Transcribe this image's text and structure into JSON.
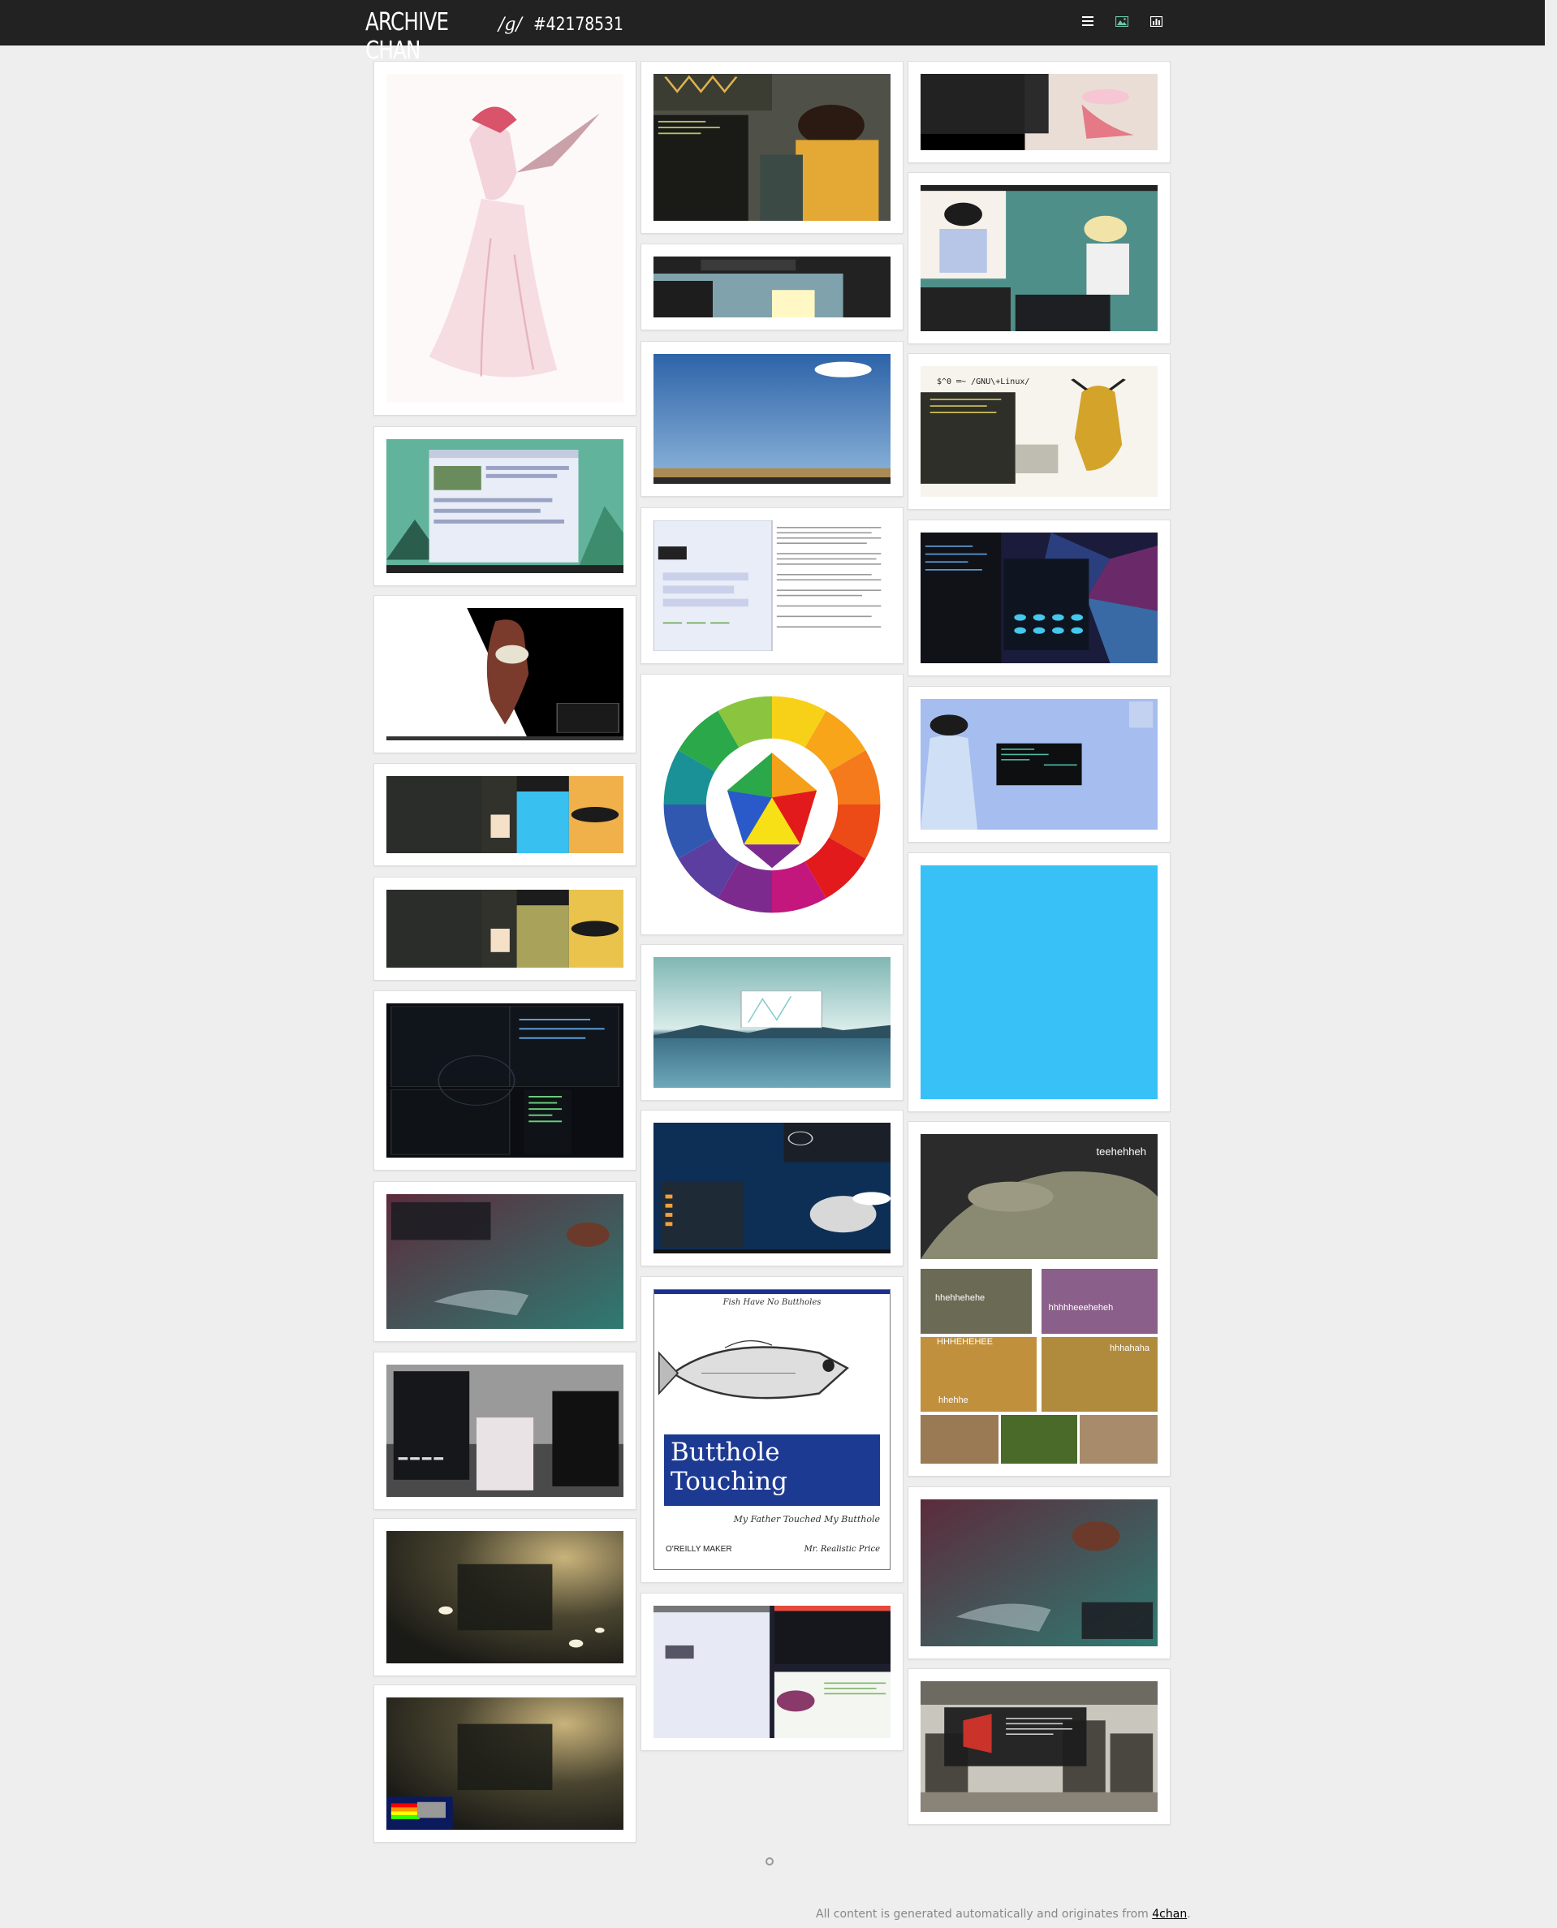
{
  "header": {
    "site_title": "ARCHIVE CHAN",
    "board": "/g/",
    "thread_id": "#42178531",
    "icons": [
      "menu-icon",
      "image-icon",
      "stats-icon"
    ]
  },
  "footer": {
    "text": "All content is generated automatically and originates from ",
    "link_text": "4chan",
    "suffix": "."
  },
  "thumbnail_captions": {
    "book_top": "Fish Have No Buttholes",
    "book_title_1": "Butthole",
    "book_title_2": "Touching",
    "book_subtitle": "My Father Touched My Butthole",
    "book_publisher": "O'REILLY MAKER",
    "book_price": "Mr. Realistic Price",
    "iguana_main": "teehehheh",
    "iguana_1": "hhehhehehe",
    "iguana_2": "hhhhheeeheheh",
    "iguana_3": "HHHEHEHEE",
    "iguana_4": "hhhahaha",
    "iguana_5": "hhehhe",
    "desktop_prompt": "$^0 ═~ /GNU\\+Linux/"
  },
  "colors": {
    "navbar": "#222222",
    "page_bg": "#eeeeee",
    "tile_bg": "#ffffff"
  }
}
